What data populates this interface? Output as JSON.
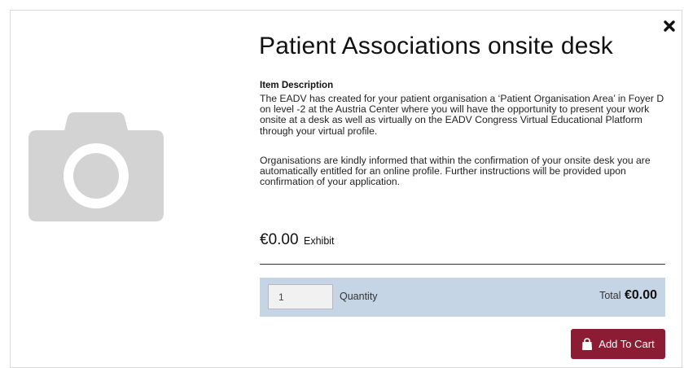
{
  "product": {
    "title": "Patient Associations onsite desk",
    "description_heading": "Item Description",
    "description_paragraph_1": "The EADV has created for your patient organisation a ‘Patient Organisation Area’ in Foyer D on level -2  at the Austria Center where you will have the opportunity to present your work onsite at a desk as well as virtually on the EADV Congress Virtual Educational Platform through your virtual profile.",
    "description_paragraph_2": "Organisations are kindly informed that within the confirmation of your onsite desk you are automatically entitled for an online profile. Further instructions will be provided upon confirmation of your application.",
    "image_icon": "camera-icon"
  },
  "price": {
    "amount": "€0.00",
    "type": "Exhibit"
  },
  "quantity": {
    "value": "1",
    "label": "Quantity"
  },
  "total": {
    "label": "Total",
    "amount": "€0.00"
  },
  "actions": {
    "add_to_cart_label": "Add To Cart",
    "close_icon": "close-icon",
    "cart_icon": "shopping-bag-icon"
  },
  "colors": {
    "accent": "#8c1c33",
    "quantity_bar": "#c6d5e5",
    "placeholder_gray": "#d3d3d3"
  }
}
